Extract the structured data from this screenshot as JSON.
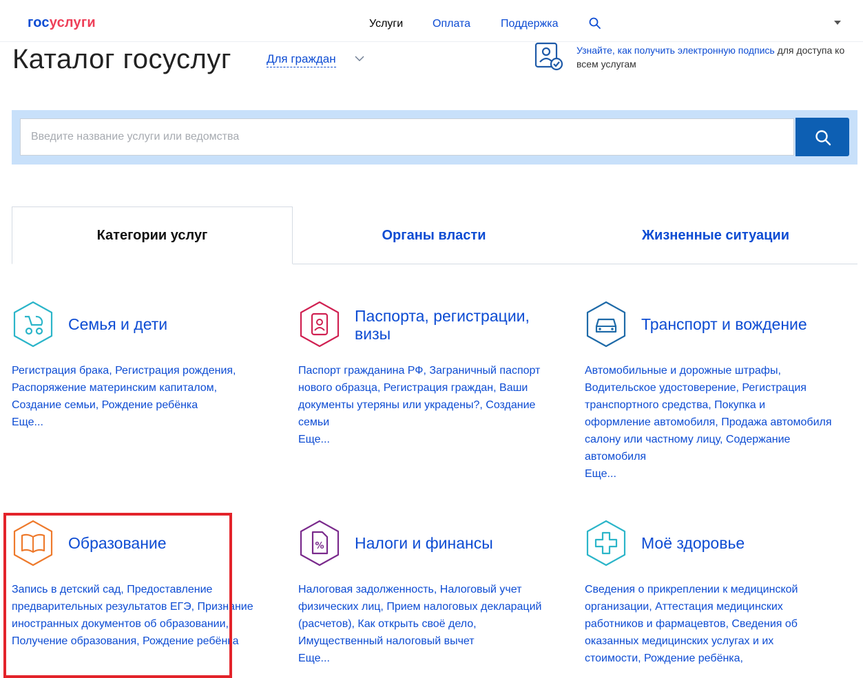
{
  "nav": {
    "logo_a": "гос",
    "logo_b": "услуги",
    "items": [
      "Услуги",
      "Оплата",
      "Поддержка"
    ]
  },
  "header": {
    "title": "Каталог госуслуг",
    "audience": "Для граждан",
    "signature_link": "Узнайте, как получить электронную подпись",
    "signature_rest": " для доступа ко всем услугам"
  },
  "search": {
    "placeholder": "Введите название услуги или ведомства",
    "value": ""
  },
  "tabs": [
    "Категории услуг",
    "Органы власти",
    "Жизненные ситуации"
  ],
  "more_label": "Еще...",
  "categories": [
    {
      "title": "Семья и дети",
      "links": "Регистрация брака, Регистрация рождения, Распоряжение материнским капиталом, Создание семьи, Рождение ребёнка",
      "icon": "stroller-icon",
      "color": "#2bb5c9"
    },
    {
      "title": "Паспорта, регистрации, визы",
      "links": "Паспорт гражданина РФ, Заграничный паспорт нового образца, Регистрация граждан, Ваши документы утеряны или украдены?, Создание семьи",
      "icon": "passport-icon",
      "color": "#d02152"
    },
    {
      "title": "Транспорт и вождение",
      "links": "Автомобильные и дорожные штрафы, Водительское удостоверение, Регистрация транспортного средства, Покупка и оформление автомобиля, Продажа автомобиля салону или частному лицу, Содержание автомобиля",
      "icon": "car-icon",
      "color": "#1e6aa8"
    },
    {
      "title": "Образование",
      "links": "Запись в детский сад, Предоставление предварительных результатов ЕГЭ, Признание иностранных документов об образовании, Получение образования, Рождение ребёнка",
      "icon": "book-icon",
      "color": "#ee7a2c"
    },
    {
      "title": "Налоги и финансы",
      "links": "Налоговая задолженность, Налоговый учет физических лиц, Прием налоговых деклараций (расчетов), Как открыть своё дело, Имущественный налоговый вычет",
      "icon": "tax-document-icon",
      "color": "#7a2a8c"
    },
    {
      "title": "Моё здоровье",
      "links": "Сведения о прикреплении к медицинской организации, Аттестация медицинских работников и фармацевтов, Сведения об оказанных медицинских услугах и их стоимости, Рождение ребёнка,",
      "icon": "medical-cross-icon",
      "color": "#2bb5c9"
    }
  ]
}
